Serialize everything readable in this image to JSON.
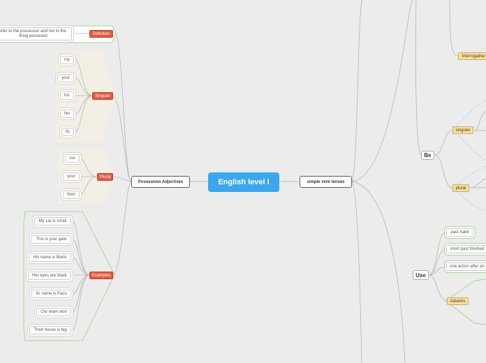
{
  "central": "English level I",
  "possessives": {
    "title": "Possesives Adjectives",
    "definition": {
      "label": "Definition",
      "text": "efer to the possessor and not to the thing possesed"
    },
    "singular": {
      "label": "Singular",
      "items": [
        "my",
        "your",
        "his",
        "her",
        "its"
      ]
    },
    "plural": {
      "label": "Plural",
      "items": [
        "our",
        "your",
        "their"
      ]
    },
    "examples": {
      "label": "Examples",
      "items": [
        "My car is small",
        "This is your gato",
        "His name is Mario",
        "Her eyes are black",
        "Its name is Paco",
        "Our team won",
        "Their house is big"
      ]
    }
  },
  "tenses": {
    "title": "simple verb tenses",
    "interrogative": "Interrogative",
    "be": {
      "label": "Be",
      "singular": "singular",
      "plural": "plural"
    },
    "use": {
      "label": "Use",
      "items": [
        "past habit",
        "short past finished",
        "one action after an"
      ],
      "adverbs": "Adverbs"
    }
  }
}
